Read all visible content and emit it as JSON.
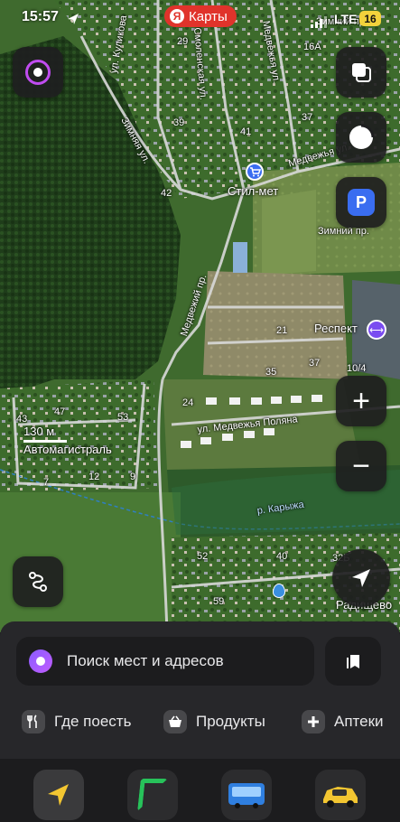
{
  "status_bar": {
    "time": "15:57",
    "network": "LTE",
    "battery": "16"
  },
  "app_badge": {
    "letter": "Я",
    "label": "Карты"
  },
  "map": {
    "streets": [
      "ул. Куликова",
      "Смоленская ул.",
      "Медвежья ул.",
      "Зимняя ул.",
      "Медвежий пр.",
      "Медвежья ул.",
      "ул. Медвежья Поляна",
      "р. Карыжа",
      "Зимний пр.",
      "Зимний пр."
    ],
    "places": [
      "Стил-мет",
      "Респект",
      "Автомагистраль",
      "Радищево"
    ],
    "house_numbers": [
      "29",
      "16А",
      "37",
      "41",
      "39",
      "42",
      "21",
      "37",
      "35",
      "10/4",
      "24",
      "47",
      "53",
      "43",
      "12",
      "9",
      "7",
      "40",
      "52",
      "59",
      "32Б"
    ],
    "scale_label": "130 м",
    "accent_blue": "#3a6df0",
    "water_color": "#2f7fc4"
  },
  "map_controls": {
    "account_icon": "account-icon",
    "layers_icon": "layers-icon",
    "traffic_icon": "traffic-circle-icon",
    "parking_label": "P",
    "zoom_in_label": "+",
    "zoom_out_label": "−",
    "route_icon": "route-icon",
    "location_icon": "location-arrow-icon"
  },
  "bottom_panel": {
    "search_placeholder": "Поиск мест и адресов",
    "categories": [
      {
        "label": "Где поесть",
        "icon": "fork-knife-icon"
      },
      {
        "label": "Продукты",
        "icon": "basket-icon"
      },
      {
        "label": "Аптеки",
        "icon": "plus-icon"
      }
    ]
  },
  "dock": {
    "apps": [
      {
        "name": "navigator",
        "color": "#3a3a3c"
      },
      {
        "name": "parking",
        "color": "#2c2c2e"
      },
      {
        "name": "transport",
        "color": "#2c2c2e"
      },
      {
        "name": "taxi",
        "color": "#2c2c2e"
      }
    ]
  }
}
